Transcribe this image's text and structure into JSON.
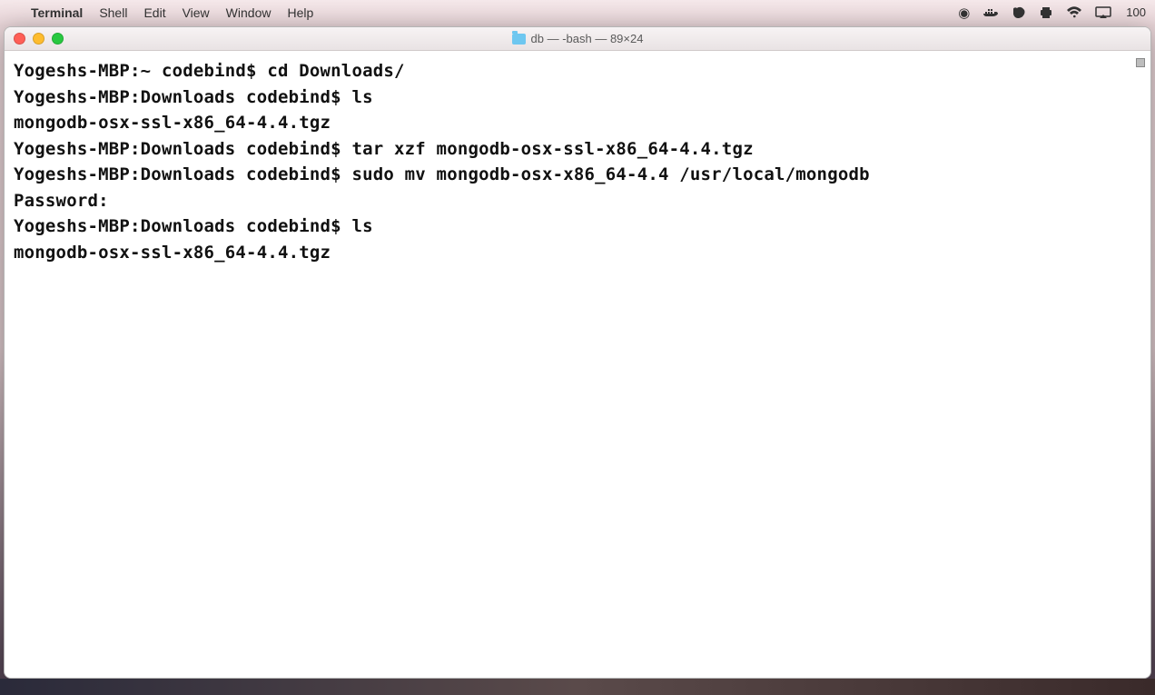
{
  "menubar": {
    "app": "Terminal",
    "items": [
      "Shell",
      "Edit",
      "View",
      "Window",
      "Help"
    ],
    "battery": "100"
  },
  "window": {
    "title": "db — -bash — 89×24"
  },
  "terminal": {
    "lines": [
      "Yogeshs-MBP:~ codebind$ cd Downloads/",
      "Yogeshs-MBP:Downloads codebind$ ls",
      "mongodb-osx-ssl-x86_64-4.4.tgz",
      "Yogeshs-MBP:Downloads codebind$ tar xzf mongodb-osx-ssl-x86_64-4.4.tgz",
      "Yogeshs-MBP:Downloads codebind$ sudo mv mongodb-osx-x86_64-4.4 /usr/local/mongodb",
      "Password:",
      "Yogeshs-MBP:Downloads codebind$ ls",
      "mongodb-osx-ssl-x86_64-4.4.tgz"
    ]
  }
}
